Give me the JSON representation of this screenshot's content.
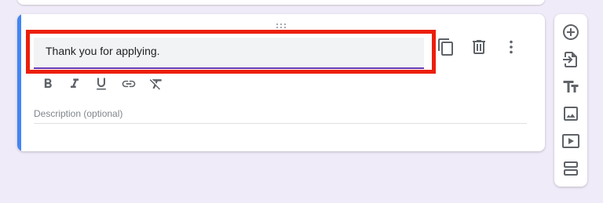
{
  "section": {
    "title_value": "Thank you for applying.",
    "description_placeholder": "Description (optional)"
  },
  "card_actions": [
    "duplicate-icon",
    "delete-icon",
    "more-vert-icon"
  ],
  "text_format": [
    "bold-icon",
    "italic-icon",
    "underline-icon",
    "link-icon",
    "clear-format-icon"
  ],
  "side_toolbar": [
    "add-question-icon",
    "import-questions-icon",
    "add-title-icon",
    "add-image-icon",
    "add-video-icon",
    "add-section-icon"
  ],
  "colors": {
    "background": "#f0ebf8",
    "accent_bar": "#4285f4",
    "title_underline": "#673ab7",
    "highlight_box": "#ec1f0a"
  }
}
